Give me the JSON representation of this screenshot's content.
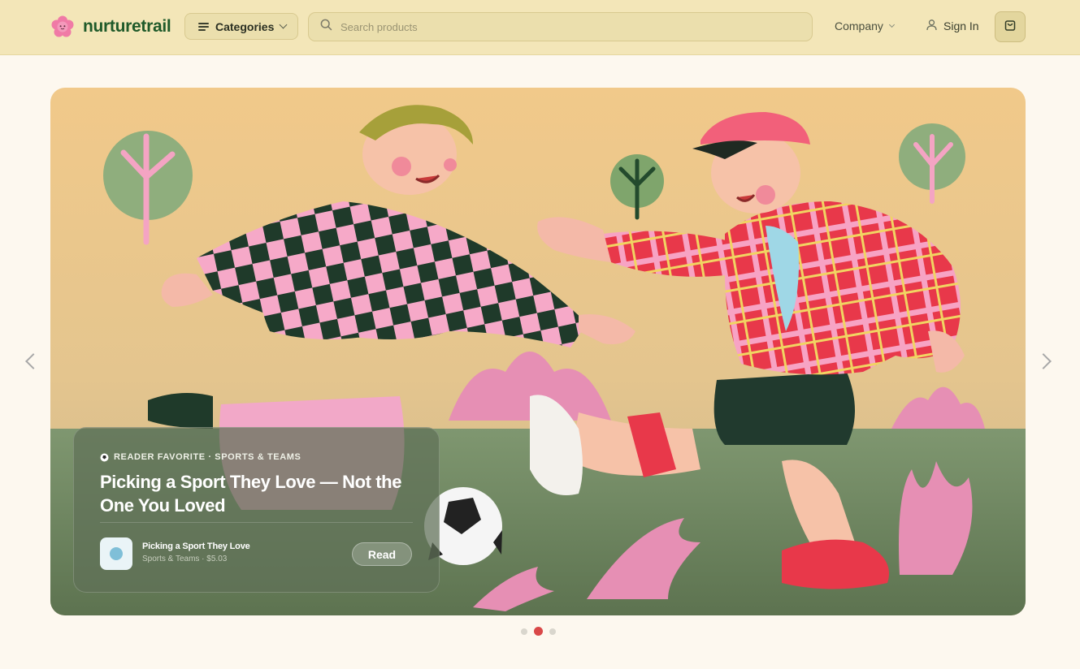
{
  "header": {
    "brand": "nurturetrail",
    "categories_label": "Categories",
    "search_placeholder": "Search products",
    "company_label": "Company",
    "signin_label": "Sign In"
  },
  "hero": {
    "eyebrow": "READER FAVORITE · SPORTS & TEAMS",
    "headline": "Picking a Sport They Love — Not the One You Loved",
    "product": {
      "title": "Picking a Sport They Love",
      "meta": "Sports & Teams · $5.03"
    },
    "read_label": "Read"
  },
  "carousel": {
    "slide_count": 3,
    "active_index": 1
  },
  "colors": {
    "header_bg": "#f3e6b8",
    "page_bg": "#fdf8ef",
    "brand_green": "#1f5a2a",
    "active_dot": "#d94848"
  },
  "icons": {
    "logo": "flower-icon",
    "categories": "menu-icon",
    "search": "search-icon",
    "signin": "user-icon",
    "cart": "shopping-bag-icon",
    "prev": "chevron-left-icon",
    "next": "chevron-right-icon"
  }
}
